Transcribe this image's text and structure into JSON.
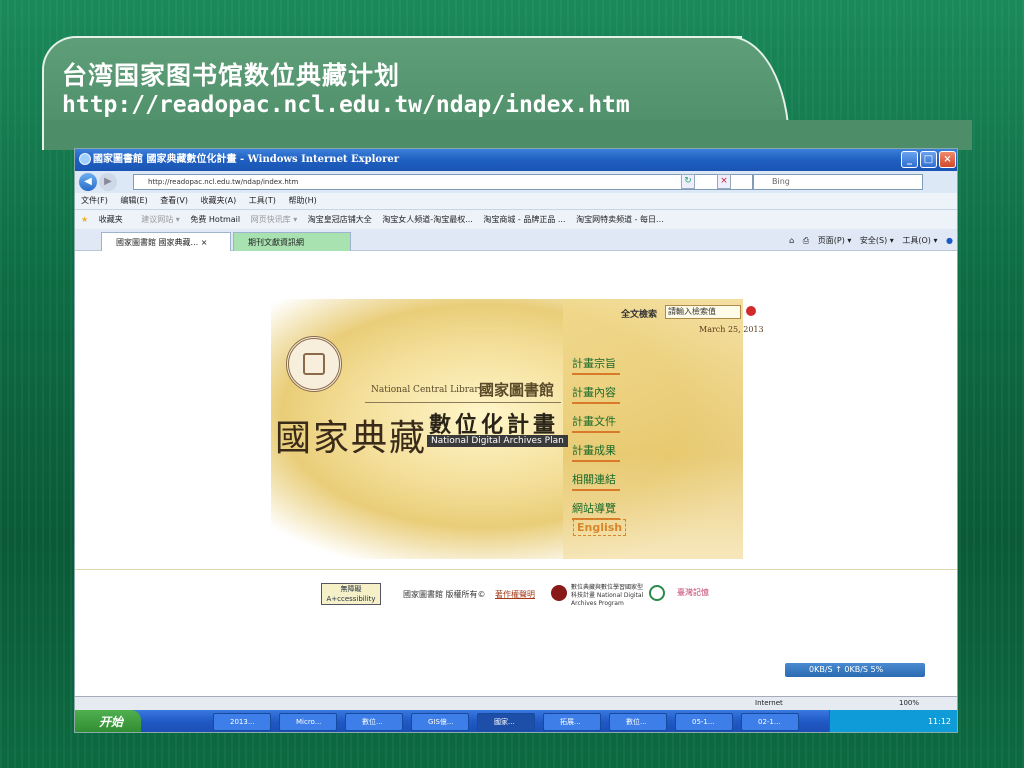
{
  "slide": {
    "title": "台湾国家图书馆数位典藏计划",
    "url": "http://readopac.ncl.edu.tw/ndap/index.htm"
  },
  "browser": {
    "window_title": "國家圖書館 國家典藏數位化計畫 - Windows Internet Explorer",
    "address": "http://readopac.ncl.edu.tw/ndap/index.htm",
    "search_placeholder": "Bing",
    "menu": [
      "文件(F)",
      "编辑(E)",
      "查看(V)",
      "收藏夹(A)",
      "工具(T)",
      "帮助(H)"
    ],
    "favorites": [
      "收藏夹",
      "建议网站 ▾",
      "免费 Hotmail",
      "网页快讯库 ▾",
      "淘宝皇冠店铺大全",
      "淘宝女人频道-淘宝最权...",
      "淘宝商城 - 品牌正品 ...",
      "淘宝网特卖频道 - 每日..."
    ],
    "tabs": [
      {
        "label": "國家圖書館 國家典藏... ×"
      },
      {
        "label": "期刊文獻資訊網"
      }
    ],
    "tools": [
      "页面(P) ▾",
      "安全(S) ▾",
      "工具(O) ▾"
    ],
    "status_zone": "Internet",
    "zoom": "100%"
  },
  "site": {
    "search_label": "全文檢索",
    "search_value": "請輸入檢索值",
    "date": "March 25, 2013",
    "ncl_en": "National Central Library",
    "ncl_zh": "國家圖書館",
    "big_title": "國家典藏",
    "plan_zh": "數位化計畫",
    "plan_en": "National Digital Archives Plan",
    "menu": [
      "計畫宗旨",
      "計畫內容",
      "計畫文件",
      "計畫成果",
      "相關連結",
      "網站導覽"
    ],
    "english": "English",
    "access_label": "無障礙",
    "copyright": "國家圖書館 版權所有©",
    "copyright_link": "著作權聲明",
    "ndap_text": "數位典藏與數位學習國家型科技計畫 National Digital Archives Program",
    "logo3_text": "臺灣記憶",
    "netmeter": "0KB/S  ↑  0KB/S  5%"
  },
  "taskbar": {
    "start": "开始",
    "tasks": [
      "2013...",
      "Micro...",
      "數位...",
      "GIS億...",
      "國家...",
      "拓展...",
      "數位...",
      "05-1...",
      "02-1..."
    ],
    "clock": "11:12"
  }
}
